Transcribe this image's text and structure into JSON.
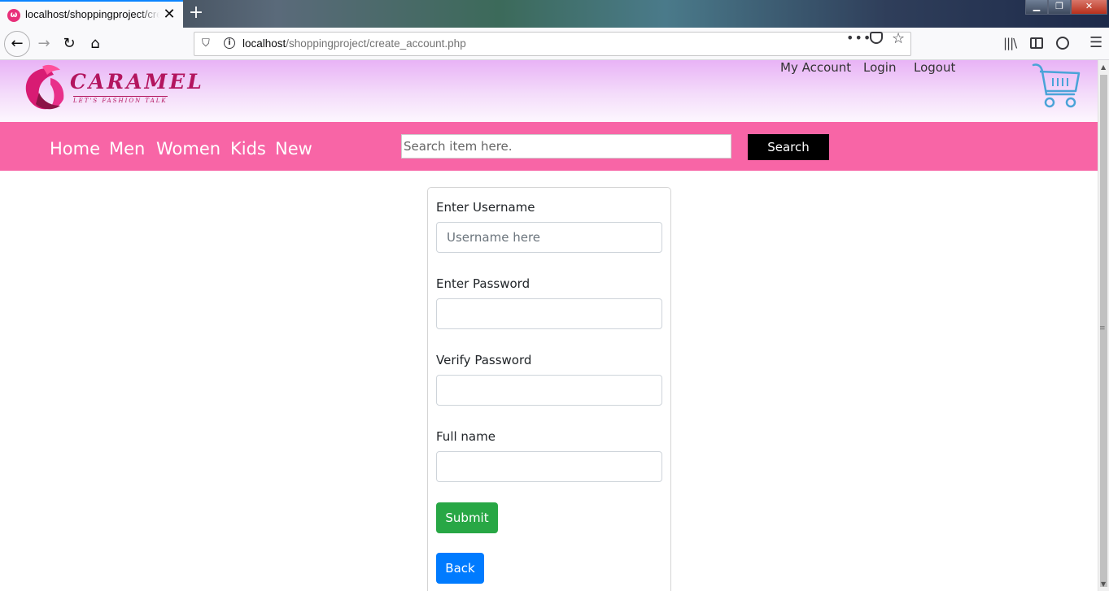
{
  "browser": {
    "tab": {
      "title": "localhost/shoppingproject/create_account.php",
      "favicon": "ω"
    },
    "url": {
      "host": "localhost",
      "path": "/shoppingproject/create_account.php"
    },
    "icons": {
      "back": "back-arrow-icon",
      "forward": "forward-arrow-icon",
      "reload": "reload-icon",
      "home": "home-icon",
      "shield": "tracking-shield-icon",
      "info": "info-icon",
      "page_actions": "more-icon",
      "pocket": "pocket-icon",
      "bookmark": "star-icon",
      "library": "library-icon",
      "sidebar": "sidebar-icon",
      "account": "account-icon",
      "menu": "hamburger-menu-icon"
    },
    "accent_color": "#0a84ff"
  },
  "header": {
    "logo": {
      "text": "CARAMEL",
      "tagline": "LET'S FASHION TALK"
    },
    "top_links": [
      "My Account",
      "Login",
      "Logout"
    ],
    "cart_icon": "shopping-cart-icon",
    "gradient_color": "#e8b2f6"
  },
  "menubar": {
    "items": [
      "Home",
      "Men",
      "Women",
      "Kids",
      "New"
    ],
    "search": {
      "placeholder": "Search item here.",
      "button": "Search"
    },
    "color": "#f865a6"
  },
  "form": {
    "username": {
      "label": "Enter Username",
      "placeholder": "Username here",
      "value": ""
    },
    "password": {
      "label": "Enter Password",
      "value": ""
    },
    "verify": {
      "label": "Verify Password",
      "value": ""
    },
    "fullname": {
      "label": "Full name",
      "value": ""
    },
    "submit": "Submit",
    "back": "Back",
    "submit_color": "#28a745",
    "back_color": "#007bff"
  }
}
